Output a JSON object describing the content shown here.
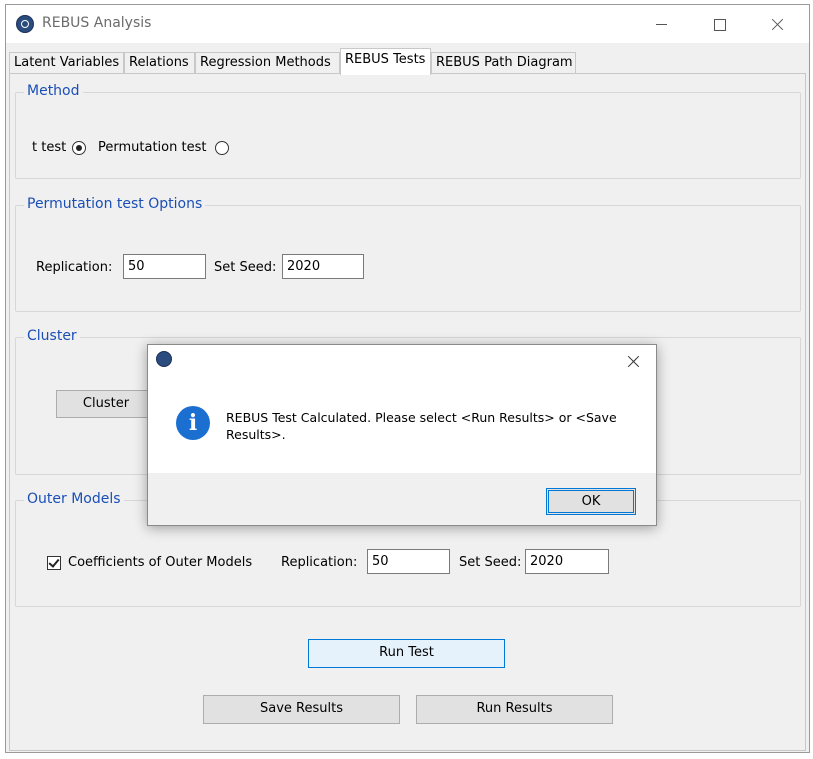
{
  "window": {
    "title": "REBUS Analysis"
  },
  "tabs": [
    {
      "label": "Latent Variables"
    },
    {
      "label": "Relations"
    },
    {
      "label": "Regression Methods"
    },
    {
      "label": "REBUS Tests",
      "active": true
    },
    {
      "label": "REBUS Path Diagram"
    }
  ],
  "method": {
    "title": "Method",
    "ttest_label": "t test",
    "permutation_label": "Permutation test",
    "selected": "t test"
  },
  "permutation_options": {
    "title": "Permutation test Options",
    "replication_label": "Replication:",
    "replication_value": "50",
    "seed_label": "Set Seed:",
    "seed_value": "2020"
  },
  "cluster": {
    "title": "Cluster",
    "button_label": "Cluster"
  },
  "outer_models": {
    "title": "Outer Models",
    "checkbox_label": "Coefficients of Outer Models",
    "checked": true,
    "replication_label": "Replication:",
    "replication_value": "50",
    "seed_label": "Set Seed:",
    "seed_value": "2020"
  },
  "buttons": {
    "run_test": "Run Test",
    "save_results": "Save Results",
    "run_results": "Run Results"
  },
  "dialog": {
    "message": "REBUS Test Calculated. Please select <Run Results> or <Save Results>.",
    "ok_label": "OK"
  },
  "colors": {
    "legend_text": "#1a4fb5",
    "info_icon": "#1a6fd1",
    "focus_border": "#0078d7"
  }
}
